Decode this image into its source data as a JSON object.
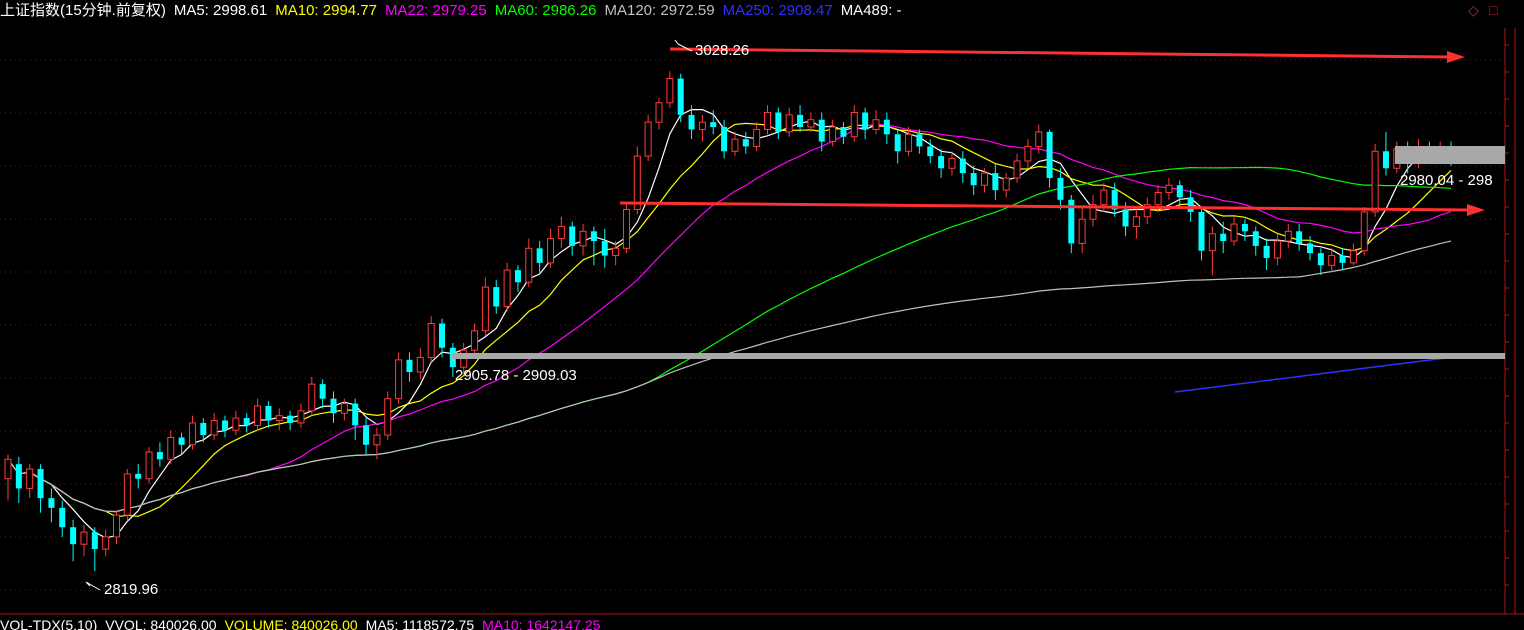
{
  "header": {
    "title": "上证指数(15分钟.前复权)",
    "ma5": "MA5: 2998.61",
    "ma10": "MA10: 2994.77",
    "ma22": "MA22: 2979.25",
    "ma60": "MA60: 2986.26",
    "ma120": "MA120: 2972.59",
    "ma250": "MA250: 2908.47",
    "ma489": "MA489: -"
  },
  "footer": {
    "vol_title": "VOL-TDX(5,10)",
    "vvol": "VVOL: 840026.00",
    "volume": "VOLUME: 840026.00",
    "ma5": "MA5: 1118572.75",
    "ma10": "MA10: 1642147.25"
  },
  "window_controls": {
    "restore": "◇",
    "maximize": "□"
  },
  "colors": {
    "background": "#000000",
    "up": "#ff3b3b",
    "down": "#00ffff",
    "ma5": "#ffffff",
    "ma10": "#ffff00",
    "ma22": "#ff00ff",
    "ma60": "#00ff00",
    "ma120": "#c0c0c0",
    "ma250": "#3030ff",
    "grid": "#7a1010",
    "trend_arrow": "#ff3030",
    "zone": "#a8a8a8"
  },
  "chart_data": {
    "type": "candlestick",
    "ylim": [
      2810,
      3045
    ],
    "annotations": {
      "high": "3028.26",
      "low": "2819.96",
      "zone1": "2905.78 - 2909.03",
      "zone2": "2980.04 - 298"
    },
    "candles": [
      [
        2860,
        2868,
        2851,
        2870
      ],
      [
        2866,
        2856,
        2850,
        2869
      ],
      [
        2856,
        2864,
        2852,
        2866
      ],
      [
        2864,
        2852,
        2846,
        2866
      ],
      [
        2852,
        2848,
        2842,
        2856
      ],
      [
        2848,
        2840,
        2836,
        2851
      ],
      [
        2840,
        2833,
        2826,
        2843
      ],
      [
        2833,
        2838,
        2828,
        2841
      ],
      [
        2838,
        2831,
        2822,
        2840
      ],
      [
        2831,
        2836,
        2828,
        2839
      ],
      [
        2836,
        2845,
        2833,
        2847
      ],
      [
        2845,
        2862,
        2843,
        2864
      ],
      [
        2862,
        2860,
        2856,
        2866
      ],
      [
        2860,
        2871,
        2858,
        2873
      ],
      [
        2871,
        2868,
        2865,
        2875
      ],
      [
        2868,
        2877,
        2866,
        2880
      ],
      [
        2877,
        2874,
        2870,
        2879
      ],
      [
        2874,
        2883,
        2872,
        2886
      ],
      [
        2883,
        2878,
        2875,
        2885
      ],
      [
        2878,
        2884,
        2876,
        2887
      ],
      [
        2884,
        2880,
        2877,
        2886
      ],
      [
        2880,
        2885,
        2878,
        2888
      ],
      [
        2885,
        2882,
        2879,
        2887
      ],
      [
        2882,
        2890,
        2880,
        2893
      ],
      [
        2890,
        2884,
        2881,
        2892
      ],
      [
        2884,
        2886,
        2880,
        2889
      ],
      [
        2886,
        2883,
        2880,
        2888
      ],
      [
        2883,
        2888,
        2881,
        2891
      ],
      [
        2888,
        2899,
        2886,
        2902
      ],
      [
        2899,
        2893,
        2889,
        2901
      ],
      [
        2893,
        2887,
        2883,
        2896
      ],
      [
        2887,
        2891,
        2884,
        2893
      ],
      [
        2891,
        2882,
        2876,
        2893
      ],
      [
        2882,
        2874,
        2870,
        2885
      ],
      [
        2874,
        2878,
        2868,
        2881
      ],
      [
        2878,
        2893,
        2876,
        2896
      ],
      [
        2893,
        2909,
        2891,
        2912
      ],
      [
        2909,
        2904,
        2900,
        2912
      ],
      [
        2904,
        2910,
        2901,
        2914
      ],
      [
        2910,
        2924,
        2908,
        2927
      ],
      [
        2924,
        2914,
        2910,
        2926
      ],
      [
        2914,
        2906,
        2902,
        2916
      ],
      [
        2906,
        2913,
        2903,
        2916
      ],
      [
        2913,
        2921,
        2911,
        2924
      ],
      [
        2921,
        2939,
        2919,
        2943
      ],
      [
        2939,
        2931,
        2928,
        2942
      ],
      [
        2931,
        2946,
        2929,
        2949
      ],
      [
        2946,
        2941,
        2937,
        2948
      ],
      [
        2941,
        2955,
        2939,
        2959
      ],
      [
        2955,
        2949,
        2945,
        2958
      ],
      [
        2949,
        2959,
        2947,
        2963
      ],
      [
        2959,
        2964,
        2955,
        2968
      ],
      [
        2964,
        2956,
        2952,
        2966
      ],
      [
        2956,
        2962,
        2952,
        2965
      ],
      [
        2962,
        2958,
        2948,
        2964
      ],
      [
        2958,
        2952,
        2947,
        2963
      ],
      [
        2952,
        2955,
        2948,
        2958
      ],
      [
        2955,
        2971,
        2953,
        2974
      ],
      [
        2971,
        2993,
        2969,
        2997
      ],
      [
        2993,
        3007,
        2991,
        3010
      ],
      [
        3007,
        3015,
        3004,
        3017
      ],
      [
        3015,
        3025,
        3013,
        3028
      ],
      [
        3025,
        3010,
        3007,
        3027
      ],
      [
        3010,
        3004,
        3000,
        3014
      ],
      [
        3004,
        3007,
        2999,
        3010
      ],
      [
        3007,
        3005,
        3002,
        3012
      ],
      [
        3005,
        2995,
        2992,
        3008
      ],
      [
        2995,
        3000,
        2993,
        3003
      ],
      [
        3000,
        2997,
        2994,
        3003
      ],
      [
        2997,
        3004,
        2995,
        3007
      ],
      [
        3004,
        3011,
        3002,
        3014
      ],
      [
        3011,
        3003,
        3000,
        3013
      ],
      [
        3003,
        3010,
        3001,
        3013
      ],
      [
        3010,
        3005,
        3003,
        3014
      ],
      [
        3005,
        3008,
        3003,
        3011
      ],
      [
        3008,
        2999,
        2995,
        3011
      ],
      [
        2999,
        3005,
        2997,
        3008
      ],
      [
        3005,
        3001,
        2998,
        3007
      ],
      [
        3001,
        3011,
        2999,
        3014
      ],
      [
        3011,
        3004,
        3000,
        3013
      ],
      [
        3004,
        3008,
        3002,
        3012
      ],
      [
        3008,
        3002,
        2998,
        3011
      ],
      [
        3002,
        2995,
        2990,
        3004
      ],
      [
        2995,
        3002,
        2993,
        3005
      ],
      [
        3002,
        2997,
        2994,
        3004
      ],
      [
        2997,
        2993,
        2990,
        3000
      ],
      [
        2993,
        2988,
        2984,
        2996
      ],
      [
        2988,
        2992,
        2985,
        2995
      ],
      [
        2992,
        2986,
        2982,
        2995
      ],
      [
        2986,
        2981,
        2977,
        2989
      ],
      [
        2981,
        2986,
        2978,
        2988
      ],
      [
        2986,
        2979,
        2975,
        2990
      ],
      [
        2979,
        2984,
        2976,
        2986
      ],
      [
        2984,
        2991,
        2982,
        2994
      ],
      [
        2991,
        2997,
        2988,
        3000
      ],
      [
        2997,
        3003,
        2994,
        3006
      ],
      [
        3003,
        2984,
        2980,
        3004
      ],
      [
        2984,
        2975,
        2971,
        2988
      ],
      [
        2975,
        2957,
        2953,
        2977
      ],
      [
        2957,
        2967,
        2953,
        2972
      ],
      [
        2967,
        2973,
        2964,
        2977
      ],
      [
        2973,
        2979,
        2970,
        2982
      ],
      [
        2979,
        2971,
        2968,
        2982
      ],
      [
        2971,
        2964,
        2960,
        2974
      ],
      [
        2964,
        2968,
        2959,
        2971
      ],
      [
        2968,
        2973,
        2965,
        2976
      ],
      [
        2973,
        2978,
        2970,
        2981
      ],
      [
        2978,
        2981,
        2975,
        2984
      ],
      [
        2981,
        2976,
        2972,
        2983
      ],
      [
        2976,
        2970,
        2966,
        2979
      ],
      [
        2970,
        2954,
        2950,
        2972
      ],
      [
        2954,
        2961,
        2944,
        2964
      ],
      [
        2961,
        2958,
        2953,
        2966
      ],
      [
        2958,
        2965,
        2956,
        2968
      ],
      [
        2965,
        2962,
        2958,
        2967
      ],
      [
        2962,
        2956,
        2952,
        2964
      ],
      [
        2956,
        2951,
        2946,
        2959
      ],
      [
        2951,
        2958,
        2948,
        2961
      ],
      [
        2958,
        2962,
        2955,
        2965
      ],
      [
        2962,
        2957,
        2954,
        2965
      ],
      [
        2957,
        2953,
        2950,
        2960
      ],
      [
        2953,
        2948,
        2944,
        2955
      ],
      [
        2948,
        2952,
        2945,
        2955
      ],
      [
        2952,
        2949,
        2946,
        2955
      ],
      [
        2949,
        2954,
        2948,
        2957
      ],
      [
        2954,
        2970,
        2952,
        2972
      ],
      [
        2970,
        2995,
        2968,
        2998
      ],
      [
        2995,
        2988,
        2985,
        3003
      ],
      [
        2988,
        2996,
        2986,
        2999
      ],
      [
        2996,
        2990,
        2986,
        2999
      ],
      [
        2990,
        2996,
        2988,
        3000
      ],
      [
        2996,
        2993,
        2990,
        2999
      ],
      [
        2993,
        2997,
        2990,
        2999
      ],
      [
        2997,
        2992,
        2989,
        2999
      ]
    ]
  }
}
